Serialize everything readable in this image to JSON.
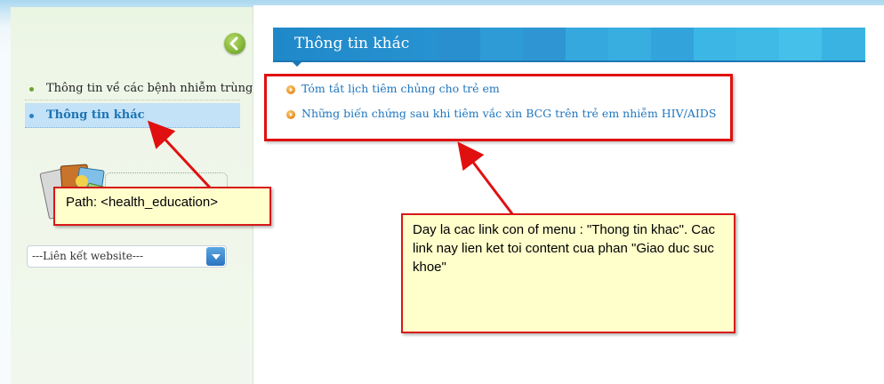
{
  "sidebar": {
    "items": [
      {
        "label": "Thông tin về các bệnh nhiễm trùng"
      },
      {
        "label": "Thông tin khác"
      }
    ],
    "select": {
      "selected": "---Liên kết website---"
    }
  },
  "main": {
    "title": "Thông tin khác",
    "links": [
      {
        "label": "Tóm tắt lịch tiêm chủng cho trẻ em"
      },
      {
        "label": "Những biến chứng sau khi tiêm vắc xin BCG trên trẻ em nhiễm HIV/AIDS"
      }
    ]
  },
  "annotations": {
    "path_note": "Path: <health_education>",
    "desc_note": "Day la cac link con of menu : \"Thong tin khac\". Cac link nay lien ket toi content cua phan \"Giao duc suc khoe\""
  },
  "colors": {
    "accent_blue": "#1f88c9",
    "link_blue": "#1f76bf",
    "annotation_red": "#e01010",
    "note_yellow": "#ffffcc",
    "sidebar_green": "#eef6e8"
  },
  "icons": {
    "back": "back-arrow-icon",
    "bullet": "orange-arrow-bullet-icon",
    "dropdown": "dropdown-arrow-icon"
  }
}
